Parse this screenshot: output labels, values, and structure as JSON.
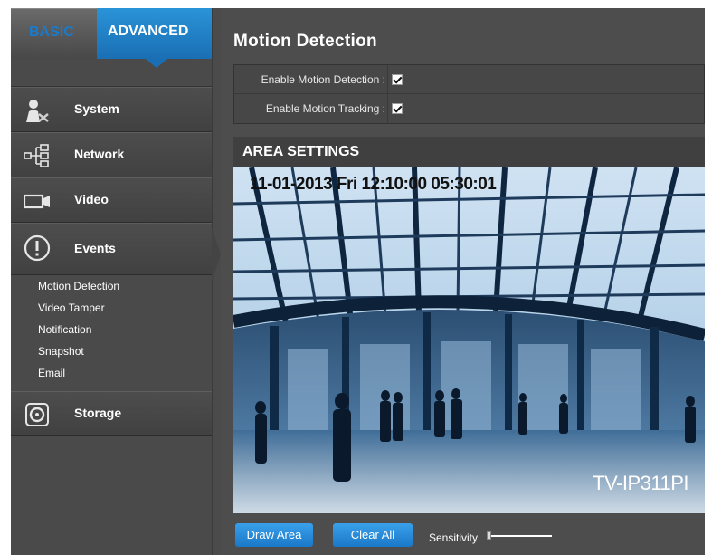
{
  "tabs": {
    "basic": "BASIC",
    "advanced": "ADVANCED"
  },
  "sidebar": {
    "items": [
      {
        "label": "System",
        "icon": "system-icon"
      },
      {
        "label": "Network",
        "icon": "network-icon"
      },
      {
        "label": "Video",
        "icon": "video-icon"
      },
      {
        "label": "Events",
        "icon": "events-icon"
      },
      {
        "label": "Storage",
        "icon": "storage-icon"
      }
    ],
    "events_submenu": [
      "Motion Detection",
      "Video Tamper",
      "Notification",
      "Snapshot",
      "Email"
    ]
  },
  "main": {
    "title": "Motion Detection",
    "settings": [
      {
        "label": "Enable Motion Detection :",
        "checked": true
      },
      {
        "label": "Enable Motion Tracking :",
        "checked": true
      }
    ],
    "area_title": "AREA SETTINGS",
    "camera": {
      "timestamp": "11-01-2013 Fri 12:10:00 05:30:01",
      "name": "TV-IP311PI"
    },
    "buttons": {
      "draw_area": "Draw Area",
      "clear_all": "Clear All"
    },
    "sensitivity_label": "Sensitivity",
    "sensitivity_level": 0.0
  },
  "colors": {
    "accent": "#1a78c8",
    "sidebar": "#4a4a4a",
    "panel": "#4d4d4d"
  }
}
